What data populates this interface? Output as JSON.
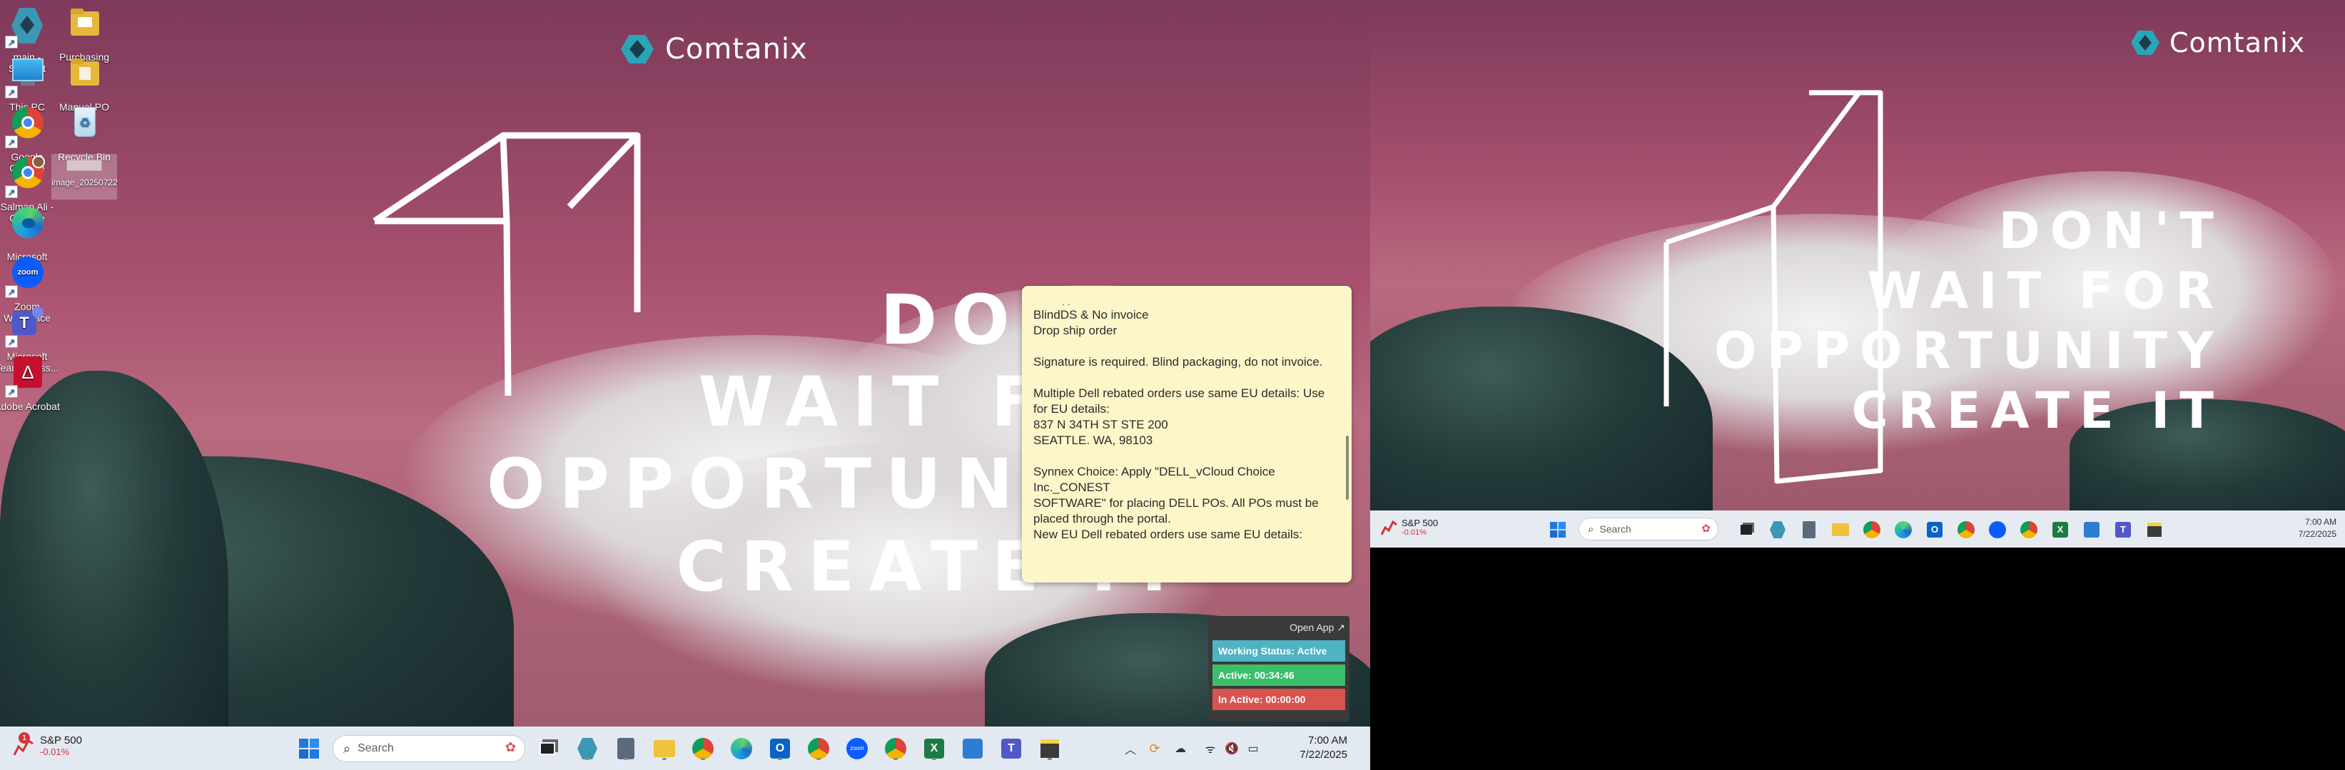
{
  "brand": {
    "name": "Comtanix"
  },
  "slogan": {
    "lines": [
      "DON'T",
      "WAIT FOR",
      "OPPORTUNITY",
      "CREATE IT"
    ]
  },
  "desktop_icons": [
    {
      "label": "main - Shortcut",
      "icon": "app-shortcut-icon"
    },
    {
      "label": "Purchasing",
      "icon": "folder-icon"
    },
    {
      "label": "This PC",
      "icon": "this-pc-icon"
    },
    {
      "label": "Manual PO",
      "icon": "folder-icon"
    },
    {
      "label": "Google Chrome",
      "icon": "chrome-icon"
    },
    {
      "label": "Recycle Bin",
      "icon": "recycle-bin-icon"
    },
    {
      "label": "Salman Ali - Chrome",
      "icon": "chrome-profile-icon"
    },
    {
      "label": "image_20250722071241",
      "icon": "image-file-icon"
    },
    {
      "label": "Microsoft Edge",
      "icon": "edge-icon"
    },
    {
      "label": "Zoom Workplace",
      "icon": "zoom-icon"
    },
    {
      "label": "Microsoft Teams class...",
      "icon": "teams-icon"
    },
    {
      "label": "Adobe Acrobat",
      "icon": "acrobat-icon"
    }
  ],
  "sticky_note": {
    "lines": [
      "BlindDS & No invoice",
      "Drop ship order",
      "",
      "Signature is required. Blind packaging, do not invoice.",
      "",
      "Multiple Dell rebated orders use same EU details: Use",
      "for EU details:",
      "837 N 34TH ST STE 200",
      "SEATTLE. WA, 98103",
      "",
      "Synnex Choice: Apply \"DELL_vCloud Choice Inc._CONEST",
      "SOFTWARE\" for placing DELL POs. All POs must be",
      "placed through the portal.",
      "New EU Dell rebated orders use same EU details:"
    ]
  },
  "tracker": {
    "open_app": "Open App ↗",
    "working_status": "Working Status: Active",
    "active": "Active: 00:34:46",
    "inactive": "In Active: 00:00:00",
    "colors": {
      "status": "#4fb3c4",
      "active": "#3bbf6a",
      "inactive": "#d9534f"
    }
  },
  "taskbar_main": {
    "stock_name": "S&P 500",
    "stock_change": "-0.01%",
    "stock_badge": "1",
    "search_placeholder": "Search",
    "time": "7:00 AM",
    "date": "7/22/2025"
  },
  "taskbar_second": {
    "stock_name": "S&P 500",
    "stock_change": "-0.01%",
    "search_placeholder": "Search",
    "time": "7:00 AM",
    "date": "7/22/2025"
  }
}
